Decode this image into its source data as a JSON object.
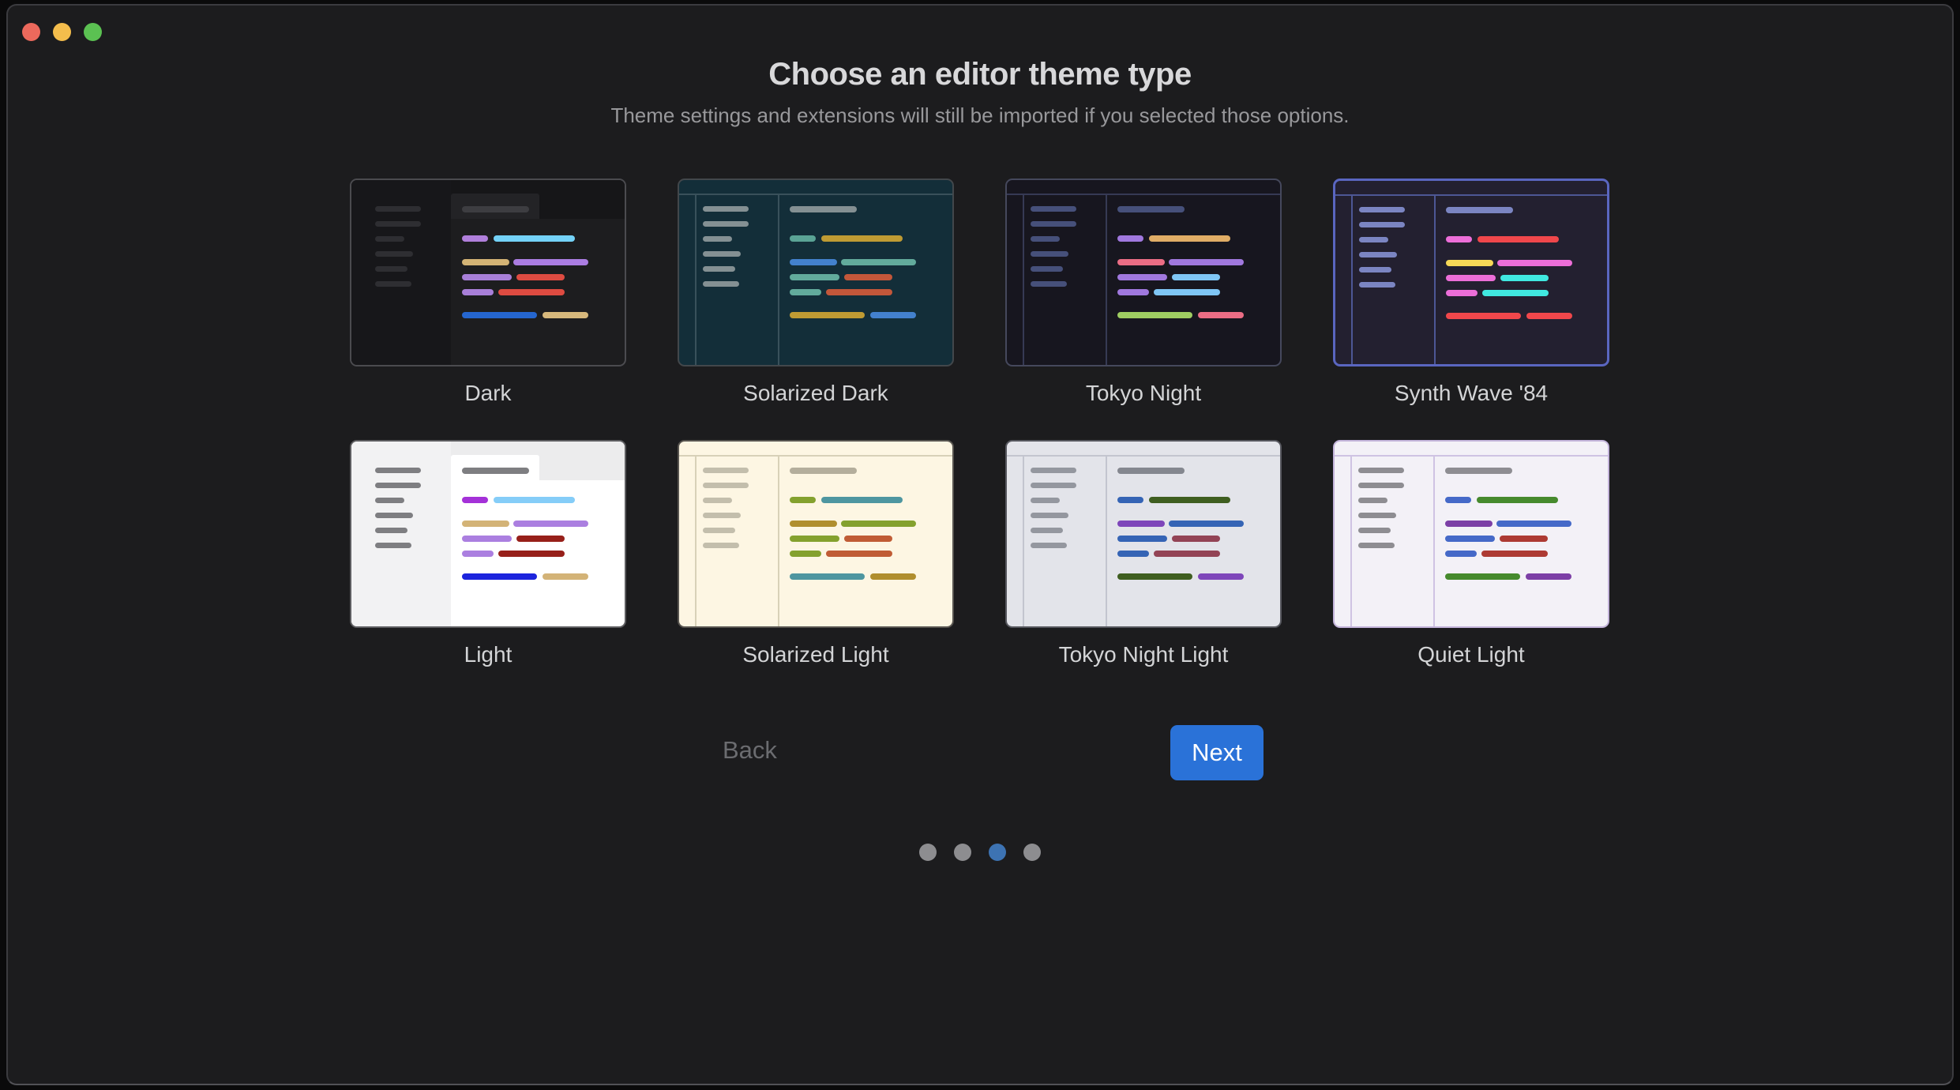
{
  "window": {
    "backdrop_color": "#0a0a0b",
    "bg_color": "#1c1c1e",
    "border_color": "#3b3b3f",
    "traffic_lights": [
      {
        "name": "close",
        "color": "#ec695c"
      },
      {
        "name": "minimize",
        "color": "#f4bd4c"
      },
      {
        "name": "maximize",
        "color": "#5bc152"
      }
    ]
  },
  "header": {
    "title": "Choose an editor theme type",
    "subtitle": "Theme settings and extensions will still be imported if you selected those options."
  },
  "themes": [
    {
      "label": "Dark",
      "variant": "tabbed",
      "selected": false,
      "colors": {
        "bg": "#1d1d1f",
        "sidebar_bg": "#17171a",
        "tabstrip": "#161618",
        "tab": "#232326",
        "frame": "#4b4b4f",
        "sidebar_line": "#2e2e32",
        "tab_line": "#3d3d41",
        "rows": [
          [
            "#b07fdb",
            "#74d2f8"
          ],
          [
            "#d3b375",
            "#ab7de2"
          ],
          [
            "#a87fd8",
            "#de4b41"
          ],
          [
            "#a87fd8",
            "#de4b41"
          ],
          [
            "#2566cf",
            "#d7b87c"
          ]
        ]
      }
    },
    {
      "label": "Solarized Dark",
      "variant": "framed",
      "selected": false,
      "colors": {
        "bg": "#132e39",
        "frame": "#42474b",
        "divider": "#39515b",
        "sidebar_line": "#849093",
        "tab_line": "#849093",
        "rows": [
          [
            "#5aa395",
            "#bf9b33"
          ],
          [
            "#4381cd",
            "#62ab9c"
          ],
          [
            "#62ab9c",
            "#c3573a"
          ],
          [
            "#62ab9c",
            "#c3573a"
          ],
          [
            "#bf9b33",
            "#4381cd"
          ]
        ]
      }
    },
    {
      "label": "Tokyo Night",
      "variant": "framed",
      "selected": false,
      "colors": {
        "bg": "#17161f",
        "frame": "#45485c",
        "divider": "#363a54",
        "sidebar_line": "#46507a",
        "tab_line": "#46507a",
        "rows": [
          [
            "#a078de",
            "#e0ad66"
          ],
          [
            "#eb6d85",
            "#a078de"
          ],
          [
            "#a078de",
            "#7fc6f5"
          ],
          [
            "#a078de",
            "#7fc6f5"
          ],
          [
            "#9fcd62",
            "#eb6d85"
          ]
        ]
      }
    },
    {
      "label": "Synth Wave '84",
      "variant": "framed",
      "selected": true,
      "colors": {
        "bg": "#232030",
        "frame": "#5a66c0",
        "divider": "#4d5795",
        "sidebar_line": "#7b85c2",
        "tab_line": "#7b85c2",
        "rows": [
          [
            "#ec6ed8",
            "#f0474b"
          ],
          [
            "#f7d957",
            "#ec6ed8"
          ],
          [
            "#ec6ed8",
            "#40e8e0"
          ],
          [
            "#ec6ed8",
            "#40e8e0"
          ],
          [
            "#f0474b",
            "#f0474b"
          ]
        ]
      }
    },
    {
      "label": "Light",
      "variant": "tabbed",
      "selected": false,
      "colors": {
        "bg": "#ffffff",
        "sidebar_bg": "#f2f2f3",
        "tabstrip": "#ececed",
        "tab": "#ffffff",
        "frame": "#5d5d60",
        "sidebar_line": "#7e7e81",
        "tab_line": "#7e7e81",
        "rows": [
          [
            "#a431d8",
            "#85cdf8"
          ],
          [
            "#d3b377",
            "#ab7fe0"
          ],
          [
            "#ab7fe0",
            "#97201a"
          ],
          [
            "#ab7fe0",
            "#97201a"
          ],
          [
            "#1c24dd",
            "#d3b377"
          ]
        ]
      }
    },
    {
      "label": "Solarized Light",
      "variant": "framed",
      "selected": false,
      "colors": {
        "bg": "#fdf6e3",
        "frame": "#585550",
        "divider": "#d8d1b8",
        "sidebar_line": "#c3beac",
        "tab_line": "#b4ae9c",
        "rows": [
          [
            "#84a12e",
            "#4e96a0"
          ],
          [
            "#b08e2e",
            "#84a12e"
          ],
          [
            "#84a12e",
            "#c05c35"
          ],
          [
            "#84a12e",
            "#c05c35"
          ],
          [
            "#4e96a0",
            "#b08e2e"
          ]
        ]
      }
    },
    {
      "label": "Tokyo Night Light",
      "variant": "framed",
      "selected": false,
      "colors": {
        "bg": "#e3e4ea",
        "frame": "#56575e",
        "divider": "#c3c5cf",
        "sidebar_line": "#94979f",
        "tab_line": "#84878f",
        "rows": [
          [
            "#3564b5",
            "#3f5e20"
          ],
          [
            "#7e46ba",
            "#3564b5"
          ],
          [
            "#3564b5",
            "#934355"
          ],
          [
            "#3564b5",
            "#934355"
          ],
          [
            "#3f5e20",
            "#7e46ba"
          ]
        ]
      }
    },
    {
      "label": "Quiet Light",
      "variant": "framed",
      "selected": false,
      "colors": {
        "bg": "#f3f1f7",
        "frame": "#c3b4da",
        "divider": "#cfc3e3",
        "sidebar_line": "#8e8d92",
        "tab_line": "#8e8d92",
        "rows": [
          [
            "#4569c8",
            "#468a2d"
          ],
          [
            "#7c3fa6",
            "#4569c8"
          ],
          [
            "#4569c8",
            "#ad3a33"
          ],
          [
            "#4569c8",
            "#ad3a33"
          ],
          [
            "#468a2d",
            "#7c3fa6"
          ]
        ]
      }
    }
  ],
  "footer": {
    "back_label": "Back",
    "next_label": "Next",
    "next_bg": "#2a72d8",
    "back_color": "#6b6c70"
  },
  "pagination": {
    "total": 4,
    "active_index": 2,
    "active_color": "#3d73b3",
    "inactive_color": "#8d8d90"
  }
}
